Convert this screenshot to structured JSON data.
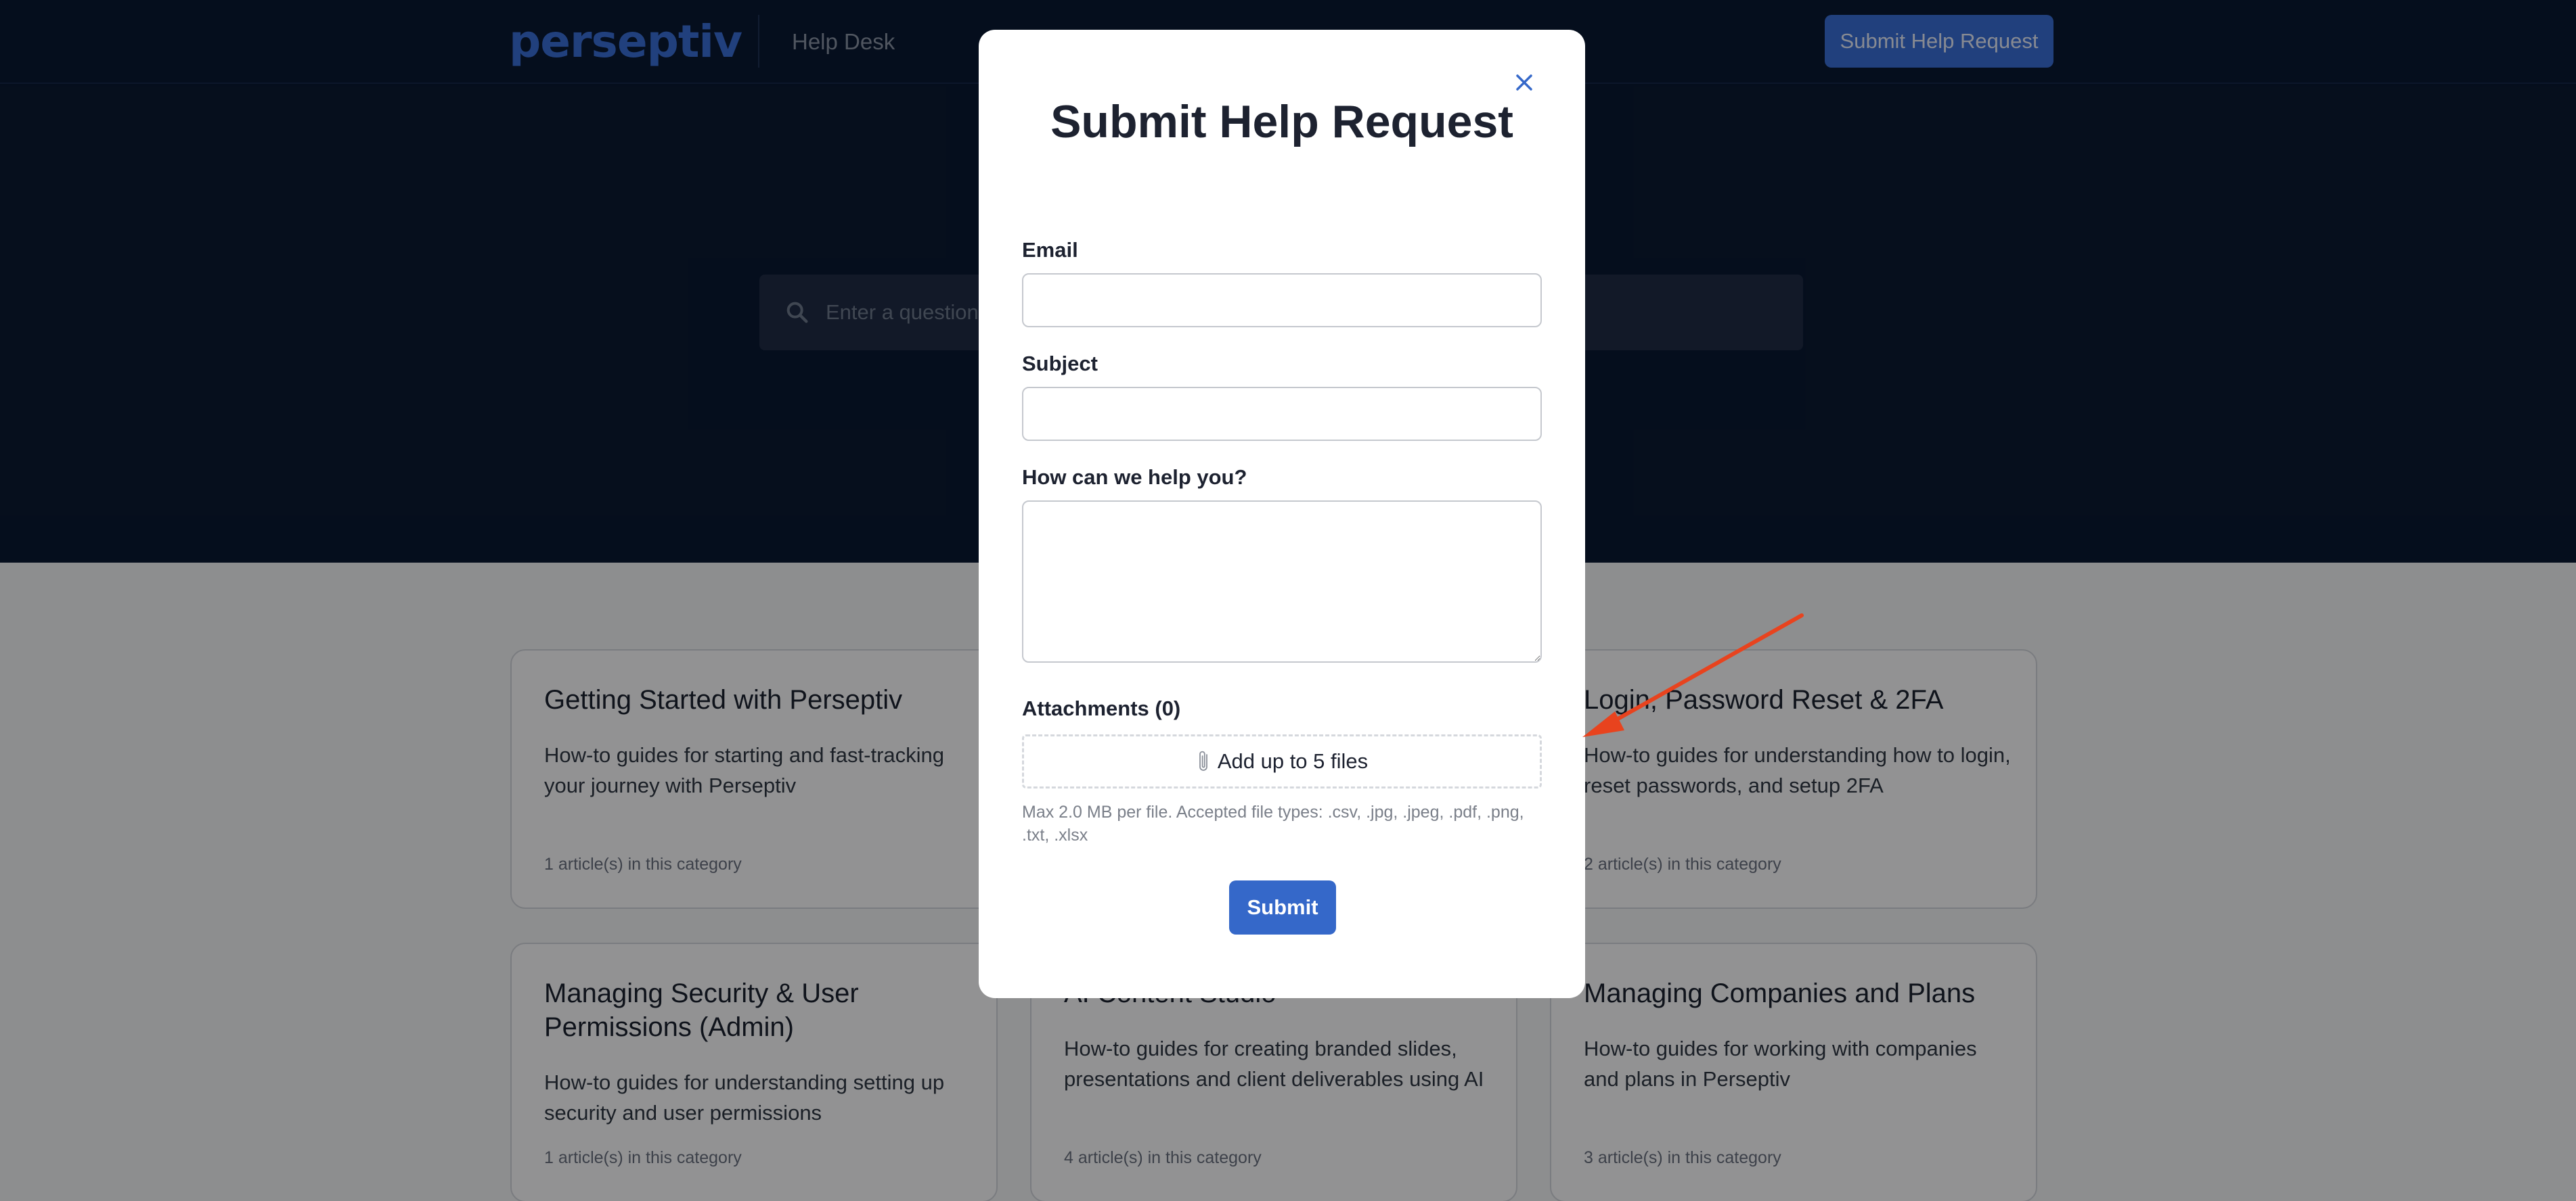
{
  "header": {
    "logo_text": "perseptiv",
    "helpdesk_label": "Help Desk",
    "submit_request_label": "Submit Help Request"
  },
  "search": {
    "placeholder": "Enter a question,"
  },
  "categories": [
    {
      "title": "Getting Started with Perseptiv",
      "description": "How-to guides for starting and fast-tracking your journey with Perseptiv",
      "count": "1 article(s) in this category"
    },
    {
      "title": "Login, Password Reset & 2FA",
      "description": "How-to guides for understanding how to login, reset passwords, and setup 2FA",
      "count": "2 article(s) in this category"
    },
    {
      "title": "Managing Security & User Permissions (Admin)",
      "description": "How-to guides for understanding setting up security and user permissions",
      "count": "1 article(s) in this category"
    },
    {
      "title": "AI Content Studio",
      "description": "How-to guides for creating branded slides, presentations and client deliverables using AI",
      "count": "4 article(s) in this category"
    },
    {
      "title": "Managing Companies and Plans",
      "description": "How-to guides for working with companies and plans in Perseptiv",
      "count": "3 article(s) in this category"
    }
  ],
  "modal": {
    "title": "Submit Help Request",
    "email_label": "Email",
    "email_value": "",
    "subject_label": "Subject",
    "subject_value": "",
    "message_label": "How can we help you?",
    "message_value": "",
    "attachments_label": "Attachments (0)",
    "attach_button_label": "Add up to 5 files",
    "attach_help": "Max 2.0 MB per file. Accepted file types: .csv, .jpg, .jpeg, .pdf, .png, .txt, .xlsx",
    "submit_label": "Submit"
  },
  "colors": {
    "hero_background": "#0a1932",
    "brand_blue": "#3a6fd8",
    "annotation_arrow": "#e8431e"
  },
  "icons": {
    "search": "search-icon",
    "close": "close-icon",
    "attachment": "paperclip-icon",
    "annotation": "arrow-annotation-icon"
  }
}
